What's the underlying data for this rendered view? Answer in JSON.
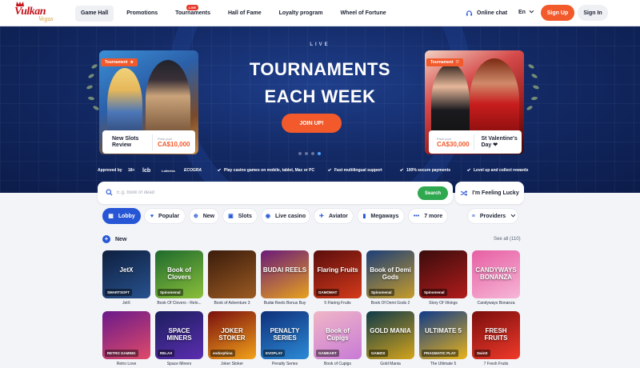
{
  "header": {
    "logo_main": "Vulkan",
    "logo_sub": "Vegas",
    "nav": [
      {
        "label": "Game Hall",
        "active": true
      },
      {
        "label": "Promotions"
      },
      {
        "label": "Tournaments",
        "badge": "LIVE"
      },
      {
        "label": "Hall of Fame"
      },
      {
        "label": "Loyalty program"
      },
      {
        "label": "Wheel of Fortune"
      }
    ],
    "chat_label": "Online chat",
    "language": "En",
    "signup_label": "Sign Up",
    "signin_label": "Sign In"
  },
  "hero": {
    "eyebrow": "LIVE",
    "title_line1": "TOURNAMENTS",
    "title_line2": "EACH WEEK",
    "cta_label": "JOIN UP!",
    "left_promo": {
      "tag": "Tournament",
      "name": "New Slots Review",
      "prize_label": "Prize pool",
      "prize_value": "CA$10,000"
    },
    "right_promo": {
      "tag": "Tournament",
      "name": "St Valentine's Day ❤",
      "prize_label": "Prize pool",
      "prize_value": "CA$30,000"
    },
    "approved_label": "Approved by",
    "regulators": [
      "18+",
      "lcb",
      "Lotteries",
      "ECOGRA"
    ],
    "features": [
      "Play casino games on mobile, tablet, Mac or PC",
      "Fast multilingual support",
      "100% secure payments",
      "Level up and collect rewards"
    ]
  },
  "search": {
    "placeholder": "E.g. book of dead",
    "button_label": "Search",
    "lucky_label": "I'm Feeling Lucky"
  },
  "categories": [
    {
      "label": "Lobby",
      "icon": "lobby-icon",
      "active": true
    },
    {
      "label": "Popular",
      "icon": "heart-icon"
    },
    {
      "label": "New",
      "icon": "plus-icon"
    },
    {
      "label": "Slots",
      "icon": "slot-icon"
    },
    {
      "label": "Live casino",
      "icon": "live-icon"
    },
    {
      "label": "Aviator",
      "icon": "aviator-icon"
    },
    {
      "label": "Megaways",
      "icon": "megaways-icon"
    },
    {
      "label": "7 more",
      "icon": "more-icon"
    }
  ],
  "providers_label": "Providers",
  "section": {
    "title": "New",
    "see_all": "See all (110)"
  },
  "games_row1": [
    {
      "name": "JetX",
      "art": "JetX",
      "provider": "SMARTSOFT",
      "colors": [
        "#0e1f3f",
        "#28528e"
      ]
    },
    {
      "name": "Book Of Clovers - Relo...",
      "art": "Book of Clovers",
      "provider": "Spinomenal",
      "colors": [
        "#1e6a2d",
        "#8bbf3a"
      ]
    },
    {
      "name": "Book of Adventure 3",
      "art": "",
      "provider": "",
      "colors": [
        "#3a1c0c",
        "#9b5a22"
      ]
    },
    {
      "name": "Budai Reels Bonus Buy",
      "art": "BUDAI REELS",
      "provider": "",
      "colors": [
        "#6a1a7a",
        "#e7a21d"
      ]
    },
    {
      "name": "5 Flaring Fruits",
      "art": "Flaring Fruits",
      "provider": "GAMOMAT",
      "colors": [
        "#5a0d0d",
        "#d43a1a"
      ]
    },
    {
      "name": "Book Of Demi Gods 2",
      "art": "Book of Demi Gods",
      "provider": "Spinomenal",
      "colors": [
        "#1d3e78",
        "#c69c2a"
      ]
    },
    {
      "name": "Story Of Vikings",
      "art": "",
      "provider": "Spinomenal",
      "colors": [
        "#3a0c0c",
        "#b11c1c"
      ]
    },
    {
      "name": "Candyways Bonanza",
      "art": "CANDYWAYS BONANZA",
      "provider": "",
      "colors": [
        "#e75fa3",
        "#f6b6d7"
      ]
    }
  ],
  "games_row2": [
    {
      "name": "Retro Love",
      "art": "",
      "provider": "RETRO GAMING",
      "colors": [
        "#6a1a8a",
        "#e04a6a"
      ]
    },
    {
      "name": "Space Miners",
      "art": "SPACE MINERS",
      "provider": "RELAX",
      "colors": [
        "#1c1f5e",
        "#5b2db0"
      ]
    },
    {
      "name": "Joker Stoker",
      "art": "JOKER STOKER",
      "provider": "endorphina",
      "colors": [
        "#7a0f0f",
        "#f2a21a"
      ]
    },
    {
      "name": "Penalty Series",
      "art": "PENALTY SERIES",
      "provider": "EVOPLAY",
      "colors": [
        "#0f2f7a",
        "#2c8ad6"
      ]
    },
    {
      "name": "Book of Cupigs",
      "art": "Book of Cupigs",
      "provider": "GAMEART",
      "colors": [
        "#f0b6c6",
        "#c87ad6"
      ]
    },
    {
      "name": "Gold Mania",
      "art": "GOLD MANIA",
      "provider": "GAMZIX",
      "colors": [
        "#0f3a4a",
        "#d4a41a"
      ]
    },
    {
      "name": "The Ultimate 5",
      "art": "ULTIMATE 5",
      "provider": "PRAGMATIC PLAY",
      "colors": [
        "#0f3a8a",
        "#e9b31a"
      ]
    },
    {
      "name": "7 Fresh Fruits",
      "art": "FRESH FRUITS",
      "provider": "Swintt",
      "colors": [
        "#7a0d0d",
        "#f03a2a"
      ]
    }
  ]
}
